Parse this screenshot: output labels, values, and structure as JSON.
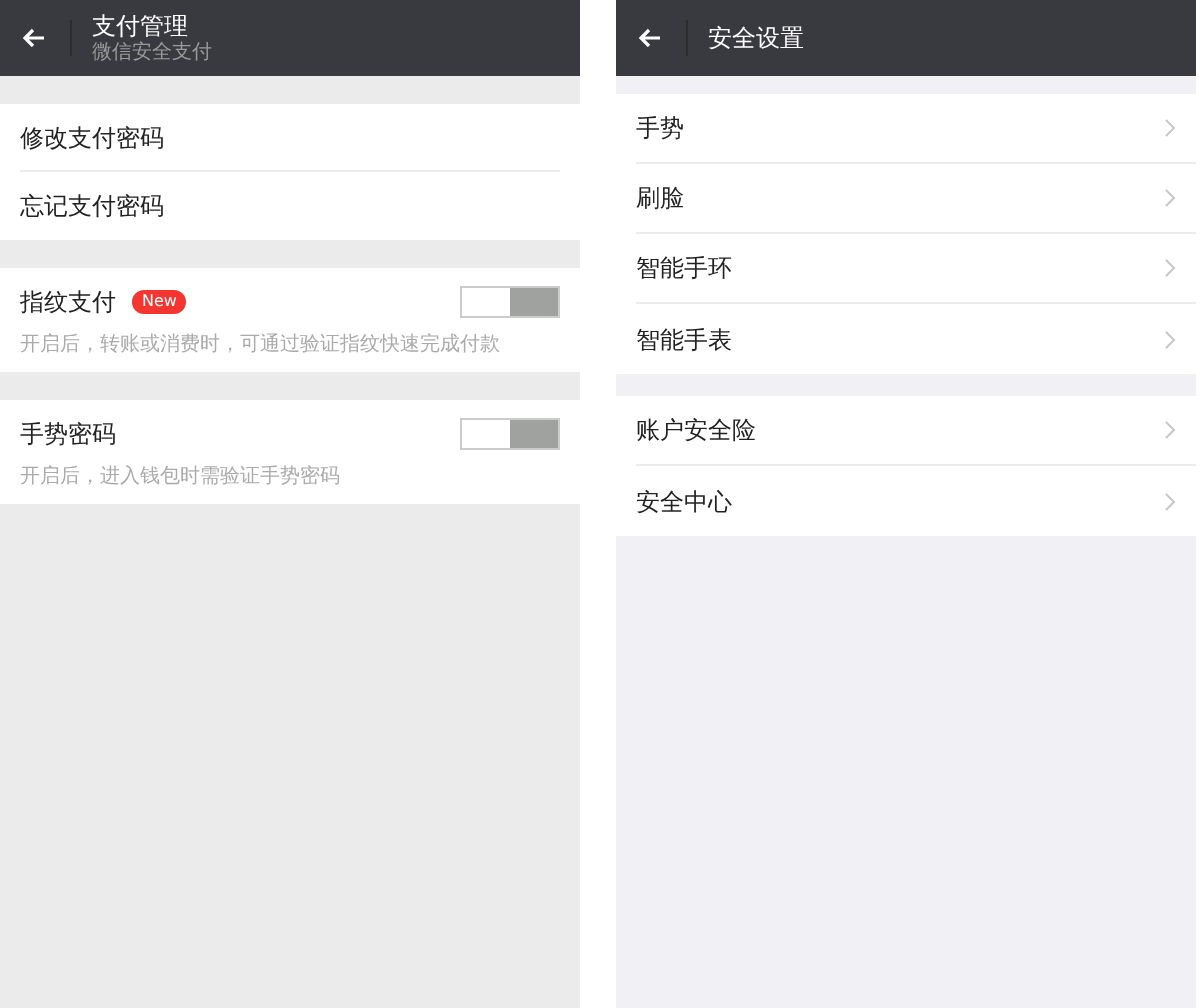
{
  "screens": [
    {
      "header": {
        "title": "支付管理",
        "subtitle": "微信安全支付"
      },
      "groups": [
        {
          "items": [
            {
              "kind": "link",
              "label": "修改支付密码"
            },
            {
              "kind": "link",
              "label": "忘记支付密码"
            }
          ]
        },
        {
          "items": [
            {
              "kind": "switch",
              "label": "指纹支付",
              "badge": "New",
              "on": false,
              "hint": "开启后，转账或消费时，可通过验证指纹快速完成付款"
            }
          ]
        },
        {
          "items": [
            {
              "kind": "switch",
              "label": "手势密码",
              "on": false,
              "hint": "开启后，进入钱包时需验证手势密码"
            }
          ]
        }
      ]
    },
    {
      "header": {
        "title": "安全设置"
      },
      "groups": [
        {
          "items": [
            {
              "kind": "chevron",
              "label": "手势"
            },
            {
              "kind": "chevron",
              "label": "刷脸"
            },
            {
              "kind": "chevron",
              "label": "智能手环"
            },
            {
              "kind": "chevron",
              "label": "智能手表"
            }
          ]
        },
        {
          "items": [
            {
              "kind": "chevron",
              "label": "账户安全险"
            },
            {
              "kind": "chevron",
              "label": "安全中心"
            }
          ]
        }
      ]
    }
  ]
}
